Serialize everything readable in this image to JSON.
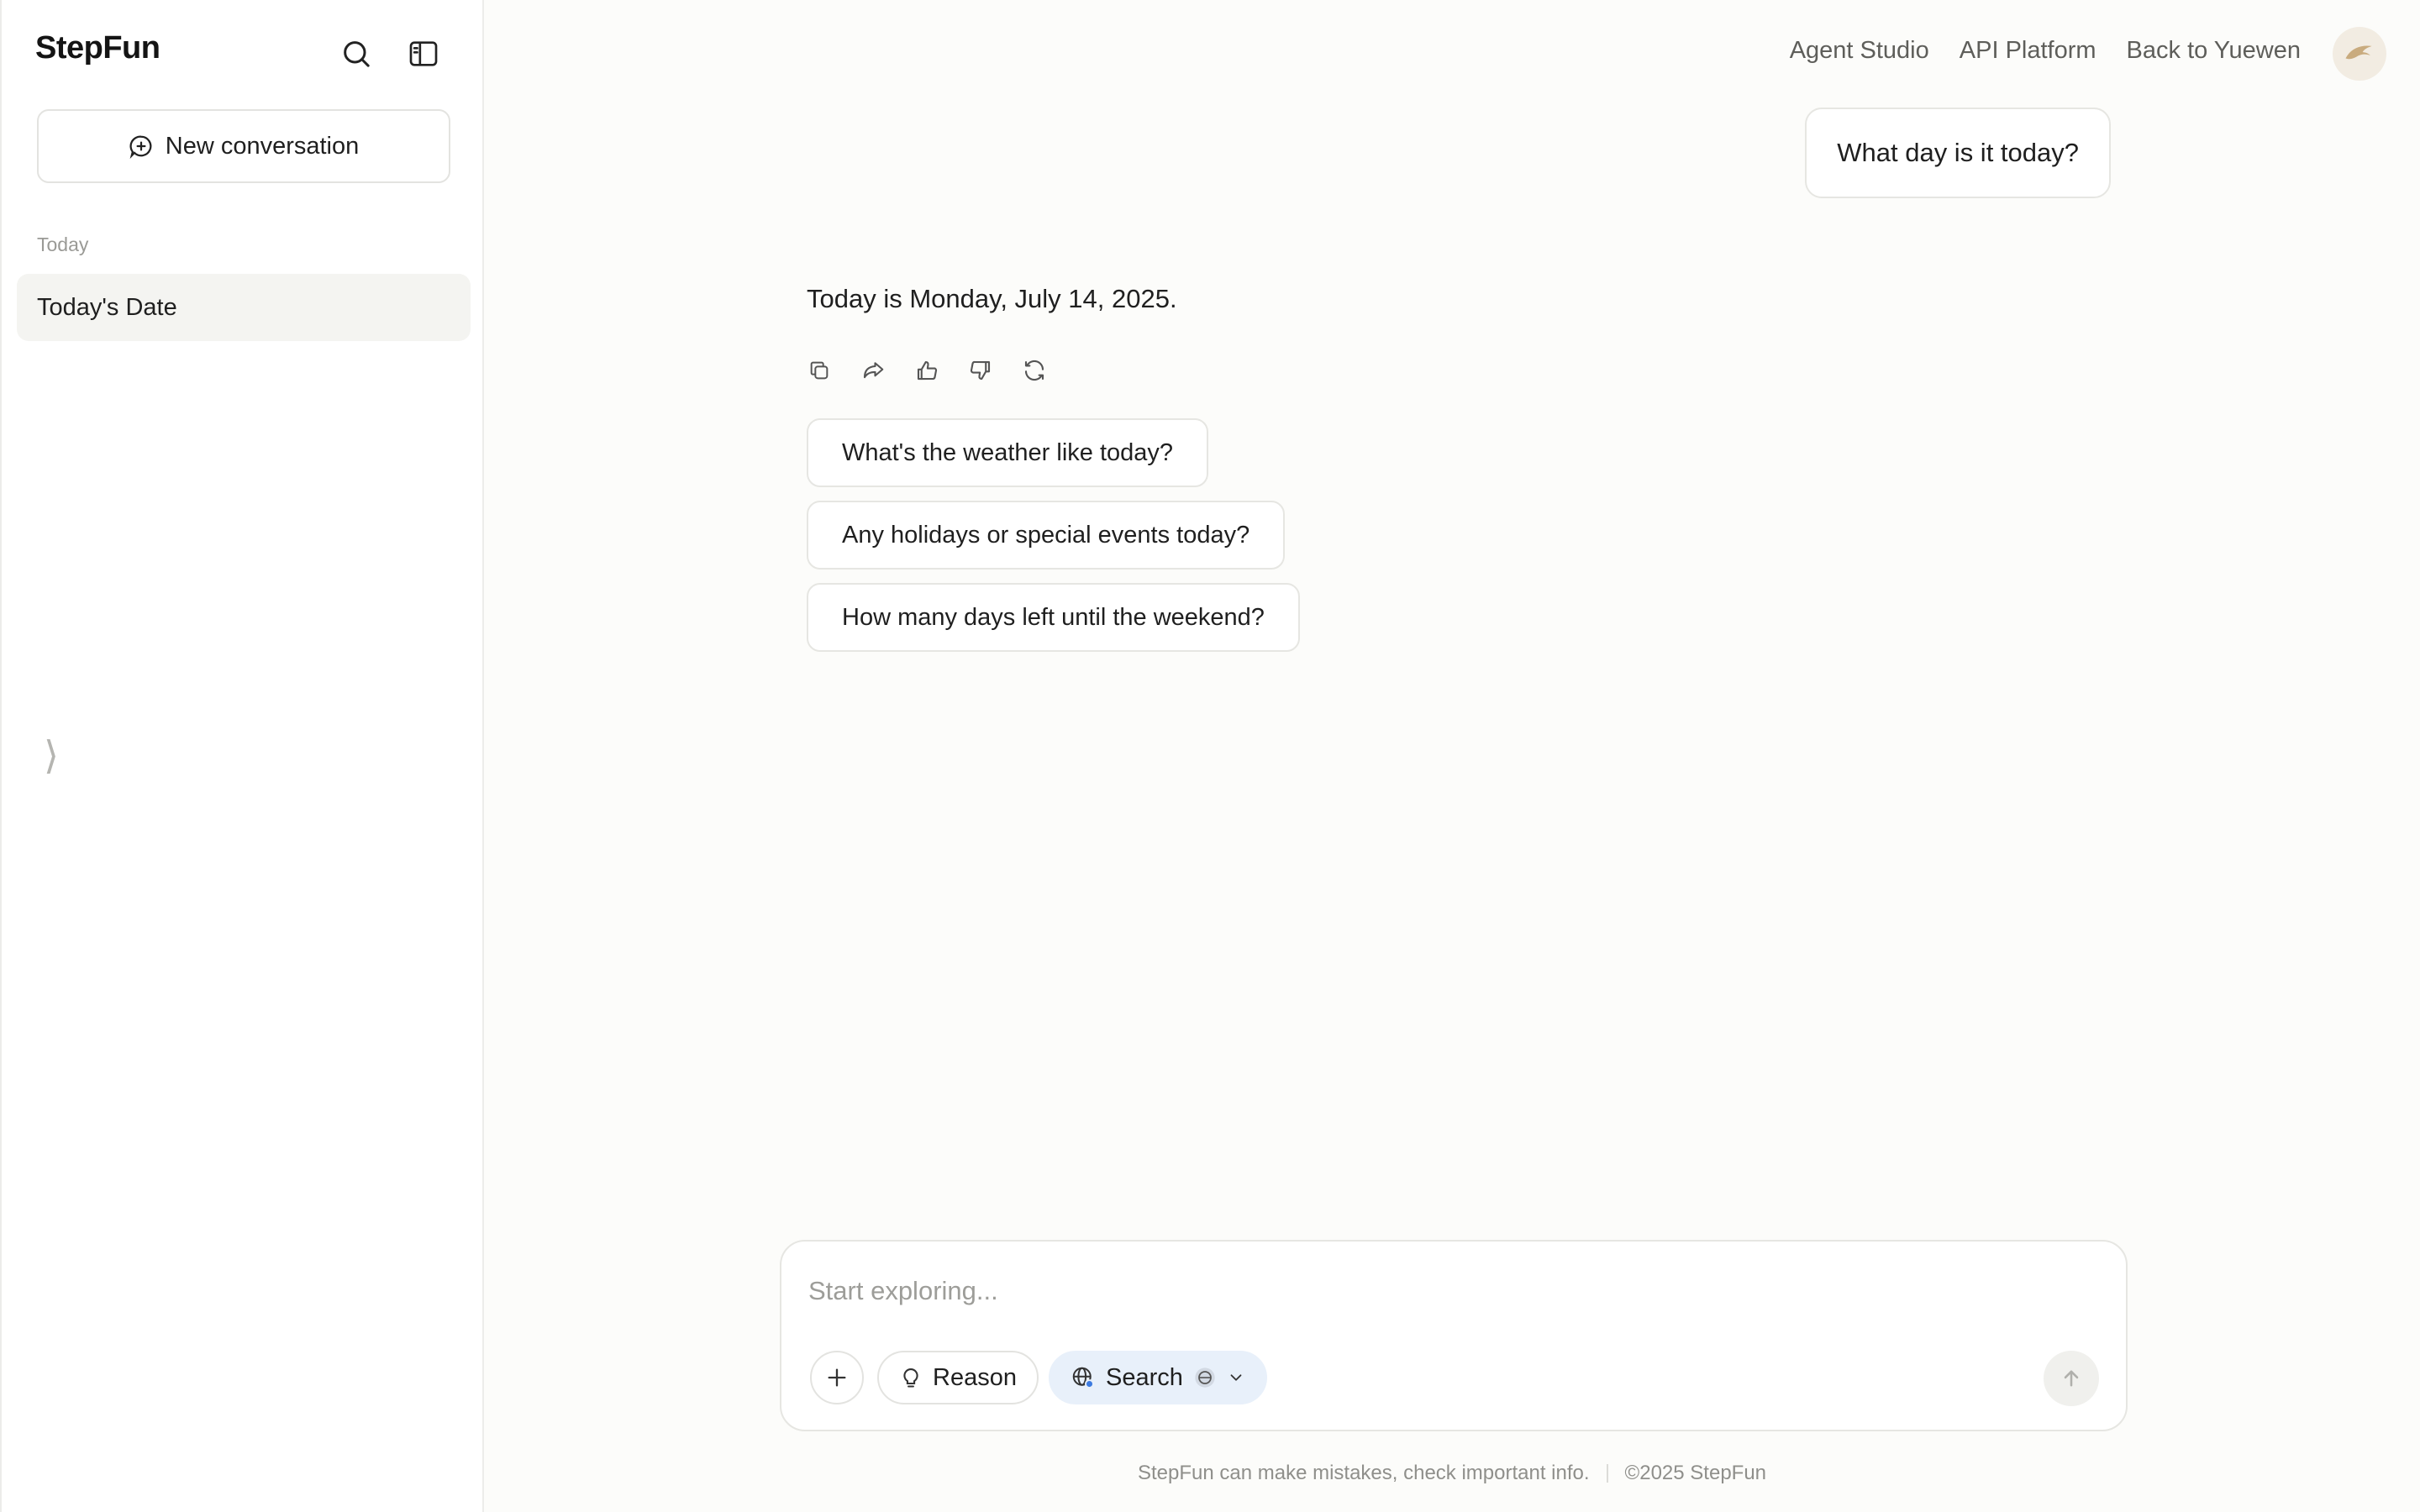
{
  "sidebar": {
    "logo": "StepFun",
    "search_icon": "search-icon",
    "toggle_icon": "sidebar-toggle-icon",
    "new_conversation": "New conversation",
    "section_today": "Today",
    "history": [
      {
        "label": "Today's Date"
      }
    ],
    "collapse_glyph": "⟩"
  },
  "topnav": {
    "links": [
      "Agent Studio",
      "API Platform",
      "Back to Yuewen"
    ]
  },
  "chat": {
    "user_message": "What day is it today?",
    "assistant_message": "Today is Monday, July 14, 2025.",
    "suggestions": [
      "What's the weather like today?",
      "Any holidays or special events today?",
      "How many days left until the weekend?"
    ]
  },
  "composer": {
    "placeholder": "Start exploring...",
    "reason_label": "Reason",
    "search_label": "Search"
  },
  "footer": {
    "disclaimer": "StepFun can make mistakes, check important info.",
    "copyright": "©2025 StepFun"
  },
  "colors": {
    "background": "#fcfcfa",
    "sidebar": "#ffffff",
    "search_pill": "#e8f0fa",
    "accent_blue": "#3d7be0"
  }
}
